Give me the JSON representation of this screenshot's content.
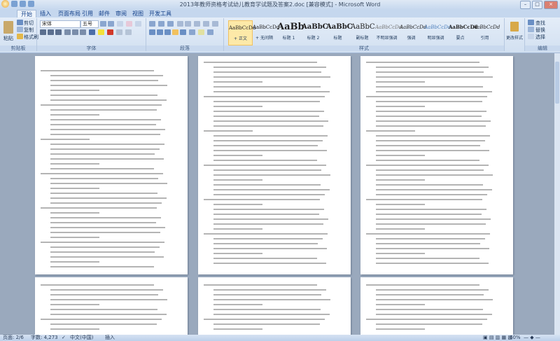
{
  "window": {
    "title": "2013年教师资格考试幼儿教育学试题及答案2.doc [兼容模式] - Microsoft Word"
  },
  "tabs": [
    "开始",
    "插入",
    "页面布局",
    "引用",
    "邮件",
    "审阅",
    "视图",
    "开发工具"
  ],
  "active_tab": "开始",
  "clipboard": {
    "paste": "粘贴",
    "cut": "剪切",
    "copy": "复制",
    "format_painter": "格式刷",
    "group": "剪贴板"
  },
  "font": {
    "name": "宋体",
    "size": "五号",
    "group": "字体"
  },
  "paragraph": {
    "group": "段落"
  },
  "styles": {
    "group": "样式",
    "items": [
      {
        "sample": "AaBbCcDd",
        "label": "+ 正文"
      },
      {
        "sample": "AaBbCcDd",
        "label": "+ 无间隔"
      },
      {
        "sample": "AaBb",
        "label": "标题 1"
      },
      {
        "sample": "AaBbC",
        "label": "标题 2"
      },
      {
        "sample": "AaBbC",
        "label": "标题"
      },
      {
        "sample": "AaBbC",
        "label": "副标题"
      },
      {
        "sample": "AaBbCcDd",
        "label": "不明显强调"
      },
      {
        "sample": "AaBbCcDd",
        "label": "强调"
      },
      {
        "sample": "AaBbCcDd",
        "label": "明显强调"
      },
      {
        "sample": "AaBbCcDd",
        "label": "要点"
      },
      {
        "sample": "AaBbCcDd",
        "label": "引用"
      }
    ],
    "change_styles": "更改样式"
  },
  "editing": {
    "find": "查找",
    "replace": "替换",
    "select": "选择",
    "group": "编辑"
  },
  "status": {
    "page": "页面: 2/6",
    "words": "字数: 4,273",
    "language": "中文(中国)",
    "mode": "插入",
    "zoom": "60%"
  }
}
